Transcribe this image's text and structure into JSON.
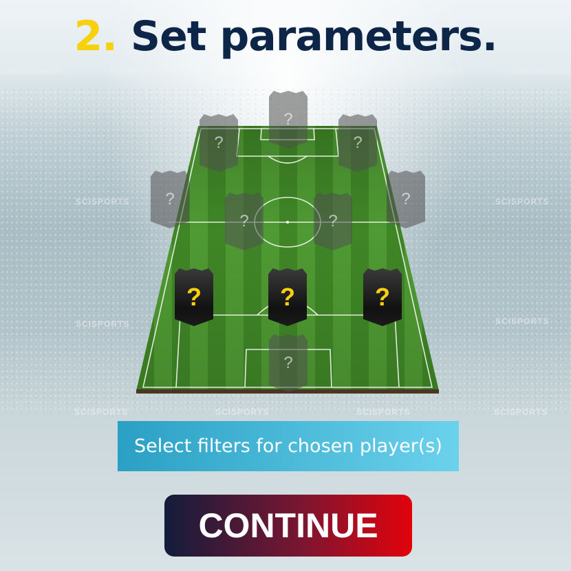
{
  "header": {
    "step_number": "2.",
    "title": "Set parameters."
  },
  "background": {
    "watermark": "SCISPORTS"
  },
  "formation": {
    "placeholder": "?",
    "positions": [
      {
        "id": "striker",
        "state": "unselected"
      },
      {
        "id": "left-forward",
        "state": "unselected"
      },
      {
        "id": "right-forward",
        "state": "unselected"
      },
      {
        "id": "left-wing",
        "state": "unselected"
      },
      {
        "id": "right-wing",
        "state": "unselected"
      },
      {
        "id": "left-midfield",
        "state": "unselected"
      },
      {
        "id": "right-midfield",
        "state": "unselected"
      },
      {
        "id": "left-back",
        "state": "selected"
      },
      {
        "id": "center-back",
        "state": "selected"
      },
      {
        "id": "right-back",
        "state": "selected"
      },
      {
        "id": "goalkeeper",
        "state": "unselected"
      }
    ]
  },
  "actions": {
    "filter_label": "Select filters for chosen player(s)",
    "continue_label": "CONTINUE"
  },
  "colors": {
    "title": "#0d2547",
    "accent_yellow": "#f7d10d",
    "filter_button": "#2aa0c4",
    "continue_start": "#131c3c",
    "continue_end": "#e2020c"
  }
}
